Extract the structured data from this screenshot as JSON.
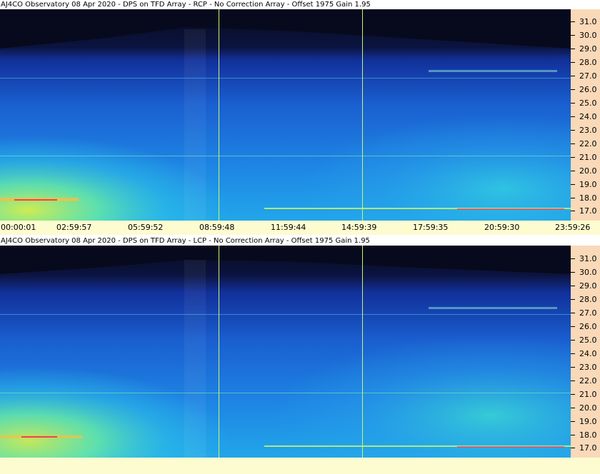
{
  "panels": [
    {
      "title": "AJ4CO Observatory 08 Apr 2020 - DPS on TFD Array  - RCP  -  No Correction Array  -  Offset 1975  Gain 1.95",
      "polarization": "RCP"
    },
    {
      "title": "AJ4CO Observatory 08 Apr 2020 - DPS on TFD Array  - LCP  -  No Correction Array  -  Offset 1975  Gain 1.95",
      "polarization": "LCP"
    }
  ],
  "frequency_labels": [
    "31.0",
    "30.0",
    "29.0",
    "28.0",
    "27.0",
    "26.0",
    "25.0",
    "24.0",
    "23.0",
    "22.0",
    "21.0",
    "20.0",
    "19.0",
    "18.0",
    "17.0"
  ],
  "time_labels": [
    "00:00:01",
    "02:59:57",
    "05:59:52",
    "08:59:48",
    "11:59:44",
    "14:59:39",
    "17:59:35",
    "20:59:30",
    "23:59:26"
  ],
  "colors": {
    "spectrogram_low": "#0a1a6b",
    "spectrogram_mid": "#1d8fe0",
    "spectrogram_high": "#5df0b0",
    "marker_line": "#c9f56a",
    "axis_bg": "#f9d9b8",
    "time_axis_bg": "#fdfbd0"
  }
}
